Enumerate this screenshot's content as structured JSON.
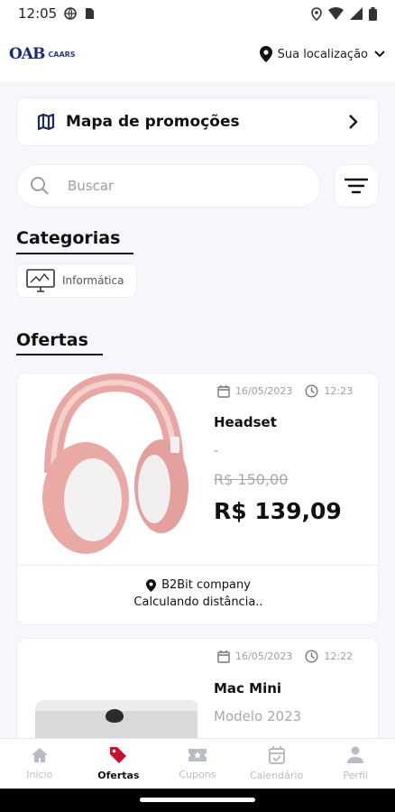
{
  "status_bar": {
    "time": "12:05"
  },
  "header": {
    "logo_main": "OAB",
    "logo_sub": "CAARS",
    "location_label": "Sua localização"
  },
  "promo_map": {
    "label": "Mapa de promoções"
  },
  "search": {
    "placeholder": "Buscar"
  },
  "categories": {
    "title": "Categorias",
    "items": [
      {
        "label": "Informática"
      }
    ]
  },
  "offers": {
    "title": "Ofertas",
    "items": [
      {
        "date": "16/05/2023",
        "time": "12:23",
        "title": "Headset",
        "subtitle": "-",
        "old_price": "R$ 150,00",
        "price": "R$ 139,09",
        "store": "B2Bit company",
        "distance": "Calculando distância.."
      },
      {
        "date": "16/05/2023",
        "time": "12:22",
        "title": "Mac Mini",
        "subtitle": "Modelo 2023"
      }
    ]
  },
  "bottom_nav": {
    "items": [
      {
        "label": "Início",
        "icon": "home-icon"
      },
      {
        "label": "Ofertas",
        "icon": "tag-icon"
      },
      {
        "label": "Cupons",
        "icon": "ticket-icon"
      },
      {
        "label": "Calendário",
        "icon": "calendar-icon"
      },
      {
        "label": "Perfil",
        "icon": "person-icon"
      }
    ],
    "active_color": "#c8102e"
  }
}
